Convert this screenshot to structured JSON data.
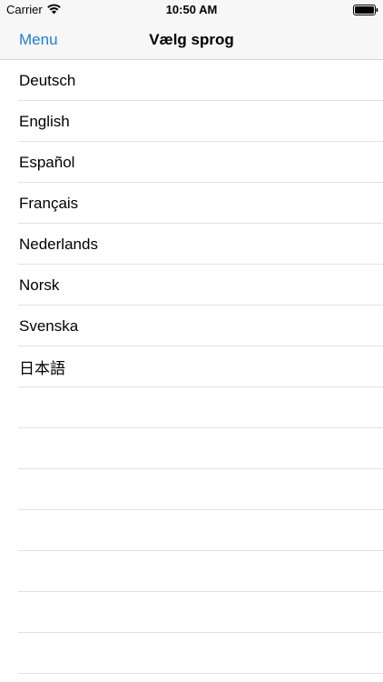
{
  "status_bar": {
    "carrier": "Carrier",
    "time": "10:50 AM"
  },
  "nav": {
    "back_label": "Menu",
    "title": "Vælg sprog",
    "accent_color": "#1a7fe0"
  },
  "languages": [
    "Deutsch",
    "English",
    "Español",
    "Français",
    "Nederlands",
    "Norsk",
    "Svenska",
    "日本語"
  ],
  "icons": {
    "status_wifi": "wifi-icon",
    "status_battery": "battery-icon"
  }
}
